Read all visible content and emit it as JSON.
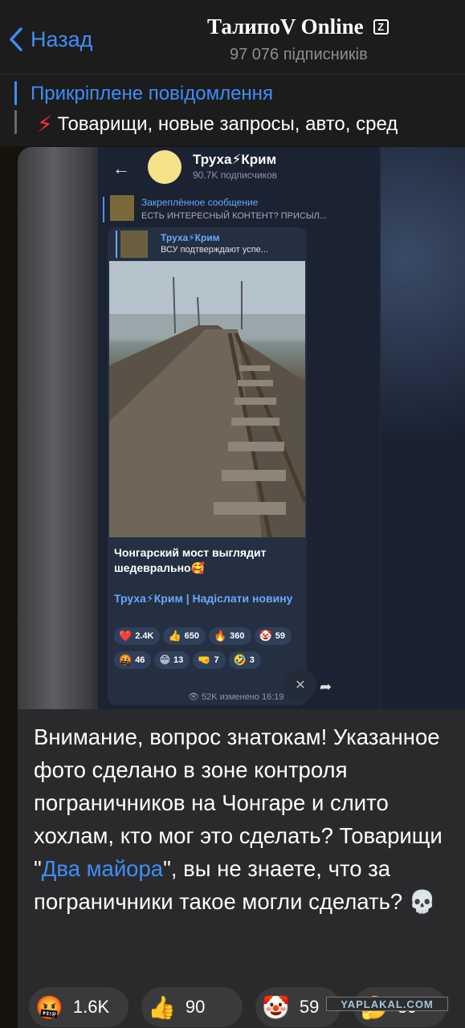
{
  "header": {
    "back_label": "Назад",
    "channel_title": "ТалипоV Online",
    "channel_badge": "Z",
    "subscribers": "97 076 підписників"
  },
  "pinned": {
    "title": "Прикріплене повідомлення",
    "text": "Товарищи, новые запросы, авто, сред",
    "icon": "lightning-icon"
  },
  "screenshot": {
    "channel_name": "Труха⚡Крим",
    "channel_subs": "90.7K подписчиков",
    "pinned_title": "Закреплённое сообщение",
    "pinned_text": "ЕСТЬ ИНТЕРЕСНЫЙ КОНТЕНТ? ПРИСЫЛ...",
    "reply_name": "Труха⚡Крим",
    "reply_text": "ВСУ подтверждают успе...",
    "caption": "Чонгарский мост выглядит шедеврально🥰",
    "link": "Труха⚡Крим | Надіслати новину",
    "reactions": [
      {
        "emoji": "❤️",
        "count": "2.4K"
      },
      {
        "emoji": "👍",
        "count": "650"
      },
      {
        "emoji": "🔥",
        "count": "360"
      },
      {
        "emoji": "🤡",
        "count": "59"
      },
      {
        "emoji": "🤬",
        "count": "46"
      },
      {
        "emoji": "😁",
        "count": "13"
      },
      {
        "emoji": "🤜",
        "count": "7"
      },
      {
        "emoji": "🤣",
        "count": "3"
      }
    ],
    "meta": "👁 52K  изменено 16:19"
  },
  "message": {
    "text_part1": "Внимание, вопрос знатокам! Указанное фото сделано в зоне контроля пограничников на Чонгаре и слито хохлам, кто мог это сделать? Товарищи \"",
    "link_text": "Два майора",
    "text_part2": "\", вы не знаете, что за пограничники такое могли сделать? 💀"
  },
  "reactions": [
    {
      "emoji": "🤬",
      "count": "1.6K"
    },
    {
      "emoji": "👍",
      "count": "90"
    },
    {
      "emoji": "🤡",
      "count": "59"
    },
    {
      "emoji": "🤔",
      "count": "39"
    }
  ],
  "watermark": "YAPLAKAL.COM"
}
